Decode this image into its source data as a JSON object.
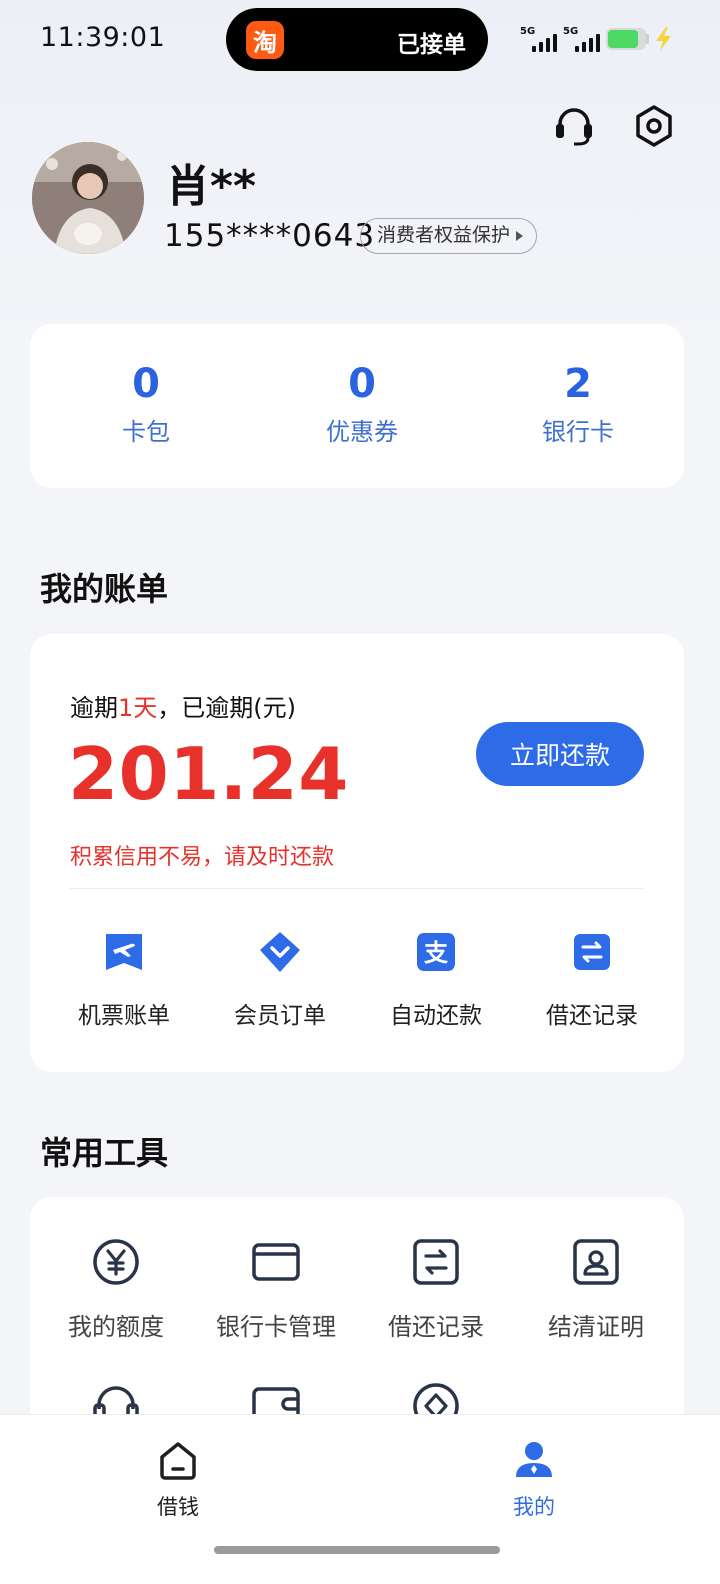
{
  "status_bar": {
    "time": "11:39:01",
    "island_app_icon": "淘",
    "island_text": "已接单",
    "network_1": "5G",
    "network_2": "5G",
    "battery_color": "#4cd964"
  },
  "header": {
    "icons": [
      "customer-service-icon",
      "settings-icon"
    ]
  },
  "profile": {
    "name": "肖**",
    "phone": "155****0643",
    "protection_tag": "消费者权益保护"
  },
  "stats": [
    {
      "value": "0",
      "label": "卡包"
    },
    {
      "value": "0",
      "label": "优惠券"
    },
    {
      "value": "2",
      "label": "银行卡"
    }
  ],
  "bill": {
    "section_title": "我的账单",
    "overdue_prefix": "逾期",
    "overdue_days": "1天",
    "overdue_suffix": "，已逾期(元)",
    "amount": "201.24",
    "repay_button": "立即还款",
    "warning": "积累信用不易，请及时还款",
    "functions": [
      {
        "icon": "airplane-ticket-icon",
        "label": "机票账单"
      },
      {
        "icon": "diamond-icon",
        "label": "会员订单"
      },
      {
        "icon": "alipay-icon",
        "label": "自动还款"
      },
      {
        "icon": "exchange-icon",
        "label": "借还记录"
      }
    ]
  },
  "tools": {
    "section_title": "常用工具",
    "items": [
      {
        "icon": "yuan-circle-icon",
        "label": "我的额度"
      },
      {
        "icon": "bank-card-icon",
        "label": "银行卡管理"
      },
      {
        "icon": "exchange-icon",
        "label": "借还记录"
      },
      {
        "icon": "certificate-icon",
        "label": "结清证明"
      }
    ],
    "partial_row_icons": [
      "headset-icon",
      "wallet-icon",
      "diamond-circle-icon"
    ]
  },
  "bottom_nav": {
    "items": [
      {
        "icon": "home-icon",
        "label": "借钱",
        "active": false
      },
      {
        "icon": "user-icon",
        "label": "我的",
        "active": true
      }
    ],
    "active_color": "#2e6be6"
  },
  "colors": {
    "accent": "#2e6be6",
    "overdue_red": "#e8312a"
  }
}
